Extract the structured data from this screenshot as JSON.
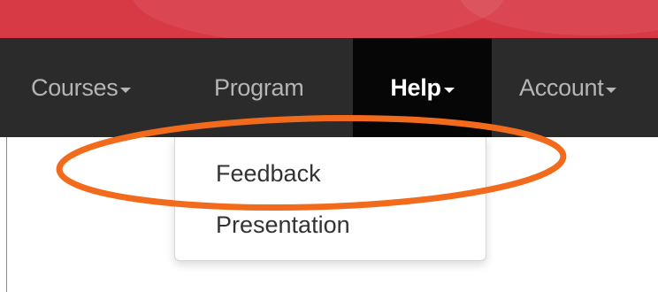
{
  "navbar": {
    "items": [
      {
        "label": "Courses",
        "has_caret": true
      },
      {
        "label": "Program",
        "has_caret": false
      },
      {
        "label": "Help",
        "has_caret": true,
        "active": true
      },
      {
        "label": "Account",
        "has_caret": true
      }
    ]
  },
  "help_menu": {
    "items": [
      {
        "label": "Feedback"
      },
      {
        "label": "Presentation"
      }
    ]
  },
  "colors": {
    "banner": "#d83a45",
    "navbar_bg": "#2b2b2b",
    "active_item_bg": "#060606",
    "annotation": "#f26b1d"
  },
  "icons": [
    "caret-down-icon"
  ],
  "annotation": {
    "shape": "ellipse",
    "target": "help-menu-item-feedback"
  }
}
